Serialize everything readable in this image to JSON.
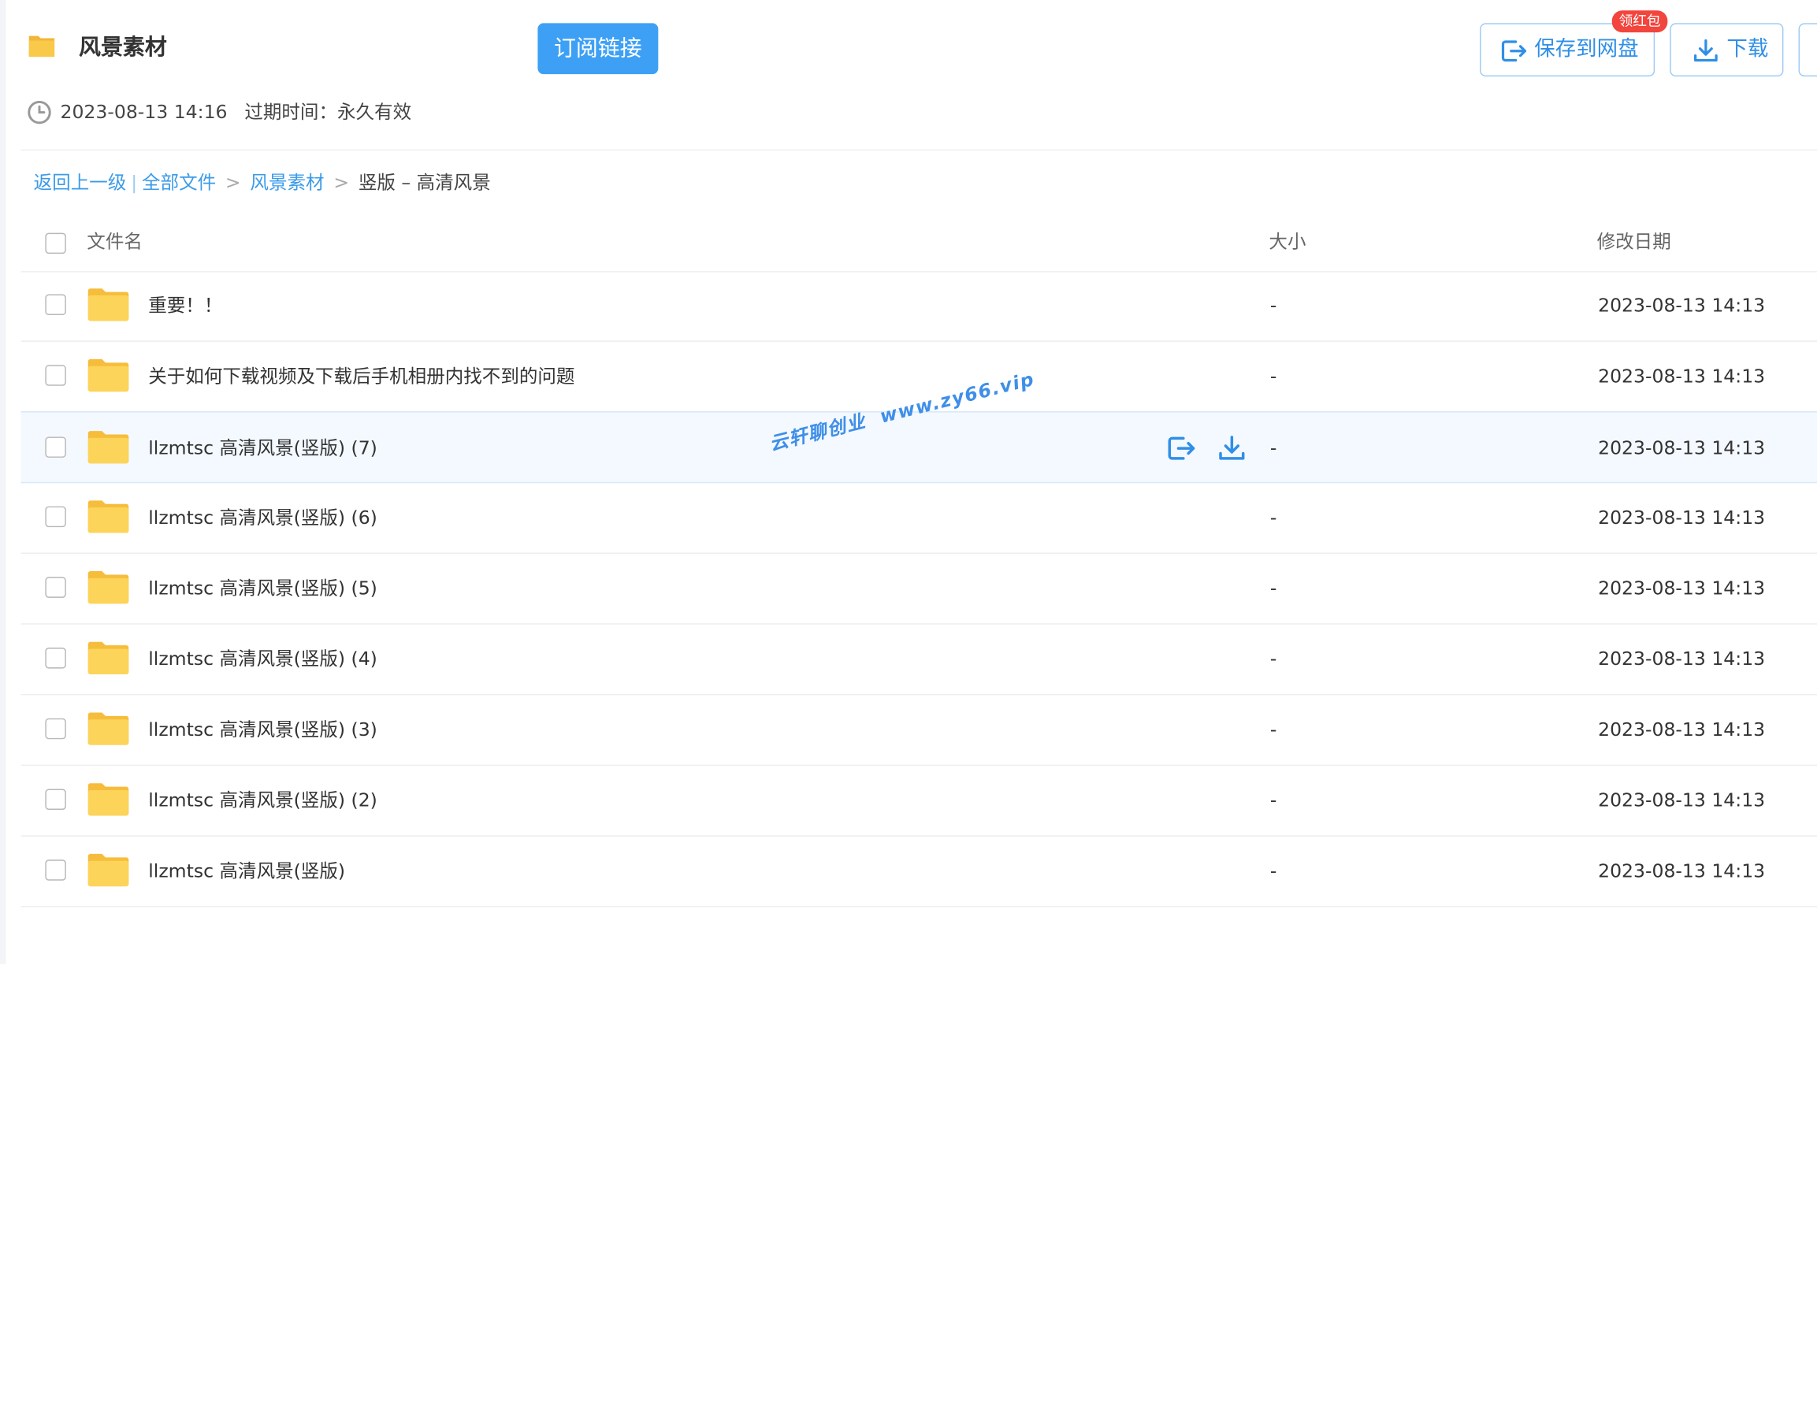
{
  "header": {
    "title": "风景素材",
    "subscribe_label": "订阅链接",
    "save_label": "保存到网盘",
    "badge_label": "领红包",
    "download_label": "下载",
    "date": "2023-08-13 14:16",
    "expire": "过期时间：永久有效",
    "icons": {
      "folder": "folder-icon",
      "save": "save-to-drive-icon",
      "download": "download-icon",
      "clock": "clock-icon"
    },
    "colors": {
      "accent": "#3da0f5",
      "link": "#3b9be8",
      "badge": "#f2453d",
      "folder": "#f9c94a"
    }
  },
  "breadcrumb": {
    "back": "返回上一级",
    "separator_bar": "|",
    "all_files": "全部文件",
    "separator": ">",
    "level1": "风景素材",
    "current": "竖版 – 高清风景"
  },
  "table": {
    "headers": {
      "name": "文件名",
      "size": "大小",
      "date": "修改日期"
    },
    "rows": [
      {
        "name": "重要！！",
        "size": "-",
        "date": "2023-08-13 14:13"
      },
      {
        "name": "关于如何下载视频及下载后手机相册内找不到的问题",
        "size": "-",
        "date": "2023-08-13 14:13"
      },
      {
        "name": "llzmtsc 高清风景(竖版) (7)",
        "size": "-",
        "date": "2023-08-13 14:13"
      },
      {
        "name": "llzmtsc 高清风景(竖版) (6)",
        "size": "-",
        "date": "2023-08-13 14:13"
      },
      {
        "name": "llzmtsc 高清风景(竖版) (5)",
        "size": "-",
        "date": "2023-08-13 14:13"
      },
      {
        "name": "llzmtsc 高清风景(竖版) (4)",
        "size": "-",
        "date": "2023-08-13 14:13"
      },
      {
        "name": "llzmtsc 高清风景(竖版) (3)",
        "size": "-",
        "date": "2023-08-13 14:13"
      },
      {
        "name": "llzmtsc 高清风景(竖版) (2)",
        "size": "-",
        "date": "2023-08-13 14:13"
      },
      {
        "name": "llzmtsc 高清风景(竖版)",
        "size": "-",
        "date": "2023-08-13 14:13"
      }
    ]
  },
  "watermark": {
    "brand": "云轩聊创业",
    "url": "www.zy66.vip"
  }
}
